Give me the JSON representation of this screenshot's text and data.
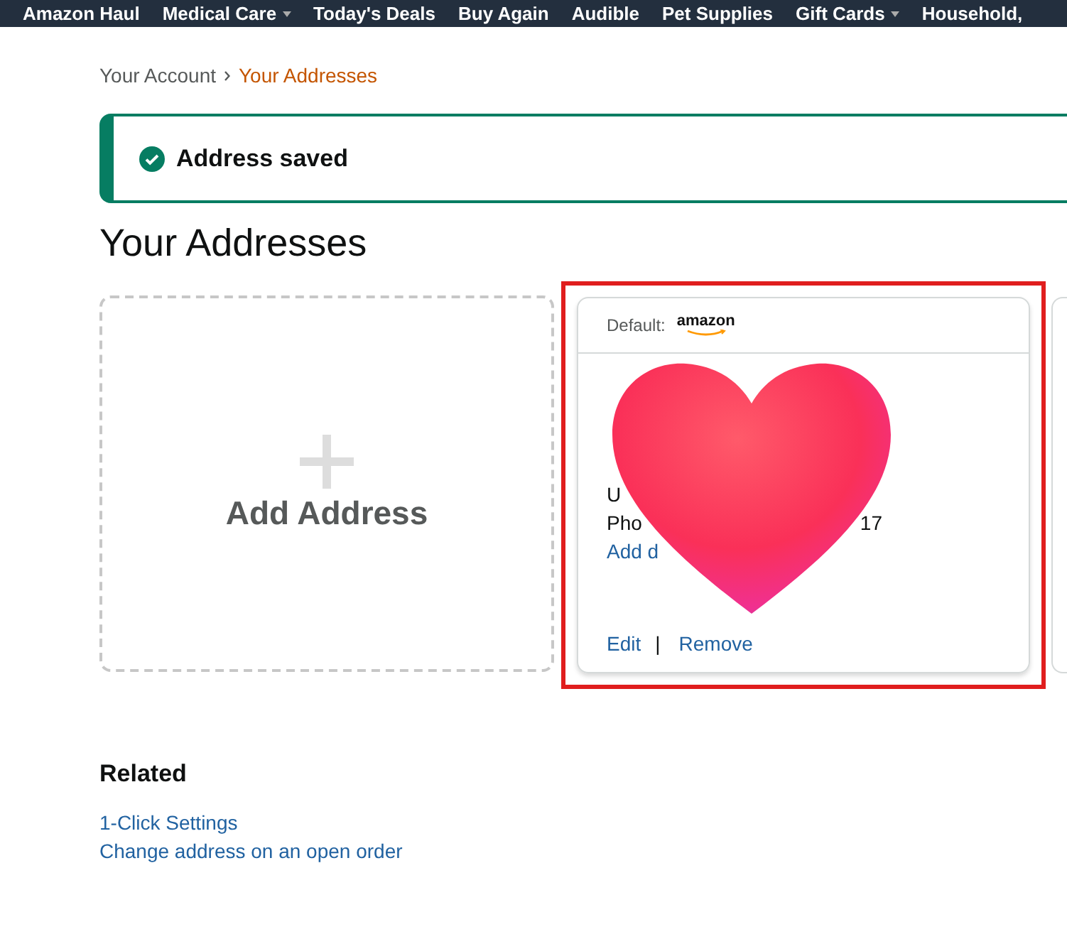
{
  "nav": {
    "items": [
      {
        "label": "Amazon Haul",
        "has_menu": false
      },
      {
        "label": "Medical Care",
        "has_menu": true
      },
      {
        "label": "Today's Deals",
        "has_menu": false
      },
      {
        "label": "Buy Again",
        "has_menu": false
      },
      {
        "label": "Audible",
        "has_menu": false
      },
      {
        "label": "Pet Supplies",
        "has_menu": false
      },
      {
        "label": "Gift Cards",
        "has_menu": true
      },
      {
        "label": "Household,",
        "has_menu": false
      }
    ]
  },
  "breadcrumb": [
    {
      "label": "Your Account",
      "current": false
    },
    {
      "label": "Your Addresses",
      "current": true
    }
  ],
  "alert": {
    "kind": "success",
    "message": "Address saved"
  },
  "heading": "Your Addresses",
  "add_card": {
    "label": "Add Address"
  },
  "address_card": {
    "highlighted": true,
    "default_label": "Default:",
    "logo_text": "amazon",
    "line_1": "U",
    "line_2_start": "Pho",
    "line_2_end": "17",
    "link_text": "Add d",
    "actions": [
      "Edit",
      "Remove"
    ],
    "separator": "|"
  },
  "related": {
    "title": "Related",
    "links": [
      "1-Click Settings",
      "Change address on an open order"
    ]
  }
}
